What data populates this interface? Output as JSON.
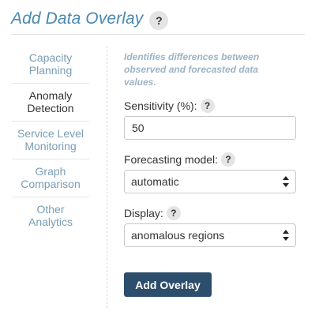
{
  "header": {
    "title": "Add Data Overlay",
    "help": "?"
  },
  "sidebar": {
    "items": [
      {
        "line1": "Capacity",
        "line2": "Planning"
      },
      {
        "line1": "Anomaly",
        "line2": "Detection"
      },
      {
        "line1": "Service Level",
        "line2": "Monitoring"
      },
      {
        "line1": "Graph",
        "line2": "Comparison"
      },
      {
        "line1": "Other",
        "line2": "Analytics"
      }
    ],
    "active_index": 1
  },
  "form": {
    "description": "Identifies differences between observed and forecasted data values.",
    "sensitivity": {
      "label": "Sensitivity (%):",
      "help": "?",
      "value": "50"
    },
    "forecasting_model": {
      "label": "Forecasting model:",
      "help": "?",
      "selected": "automatic"
    },
    "display": {
      "label": "Display:",
      "help": "?",
      "selected": "anomalous regions"
    },
    "submit_label": "Add Overlay"
  }
}
